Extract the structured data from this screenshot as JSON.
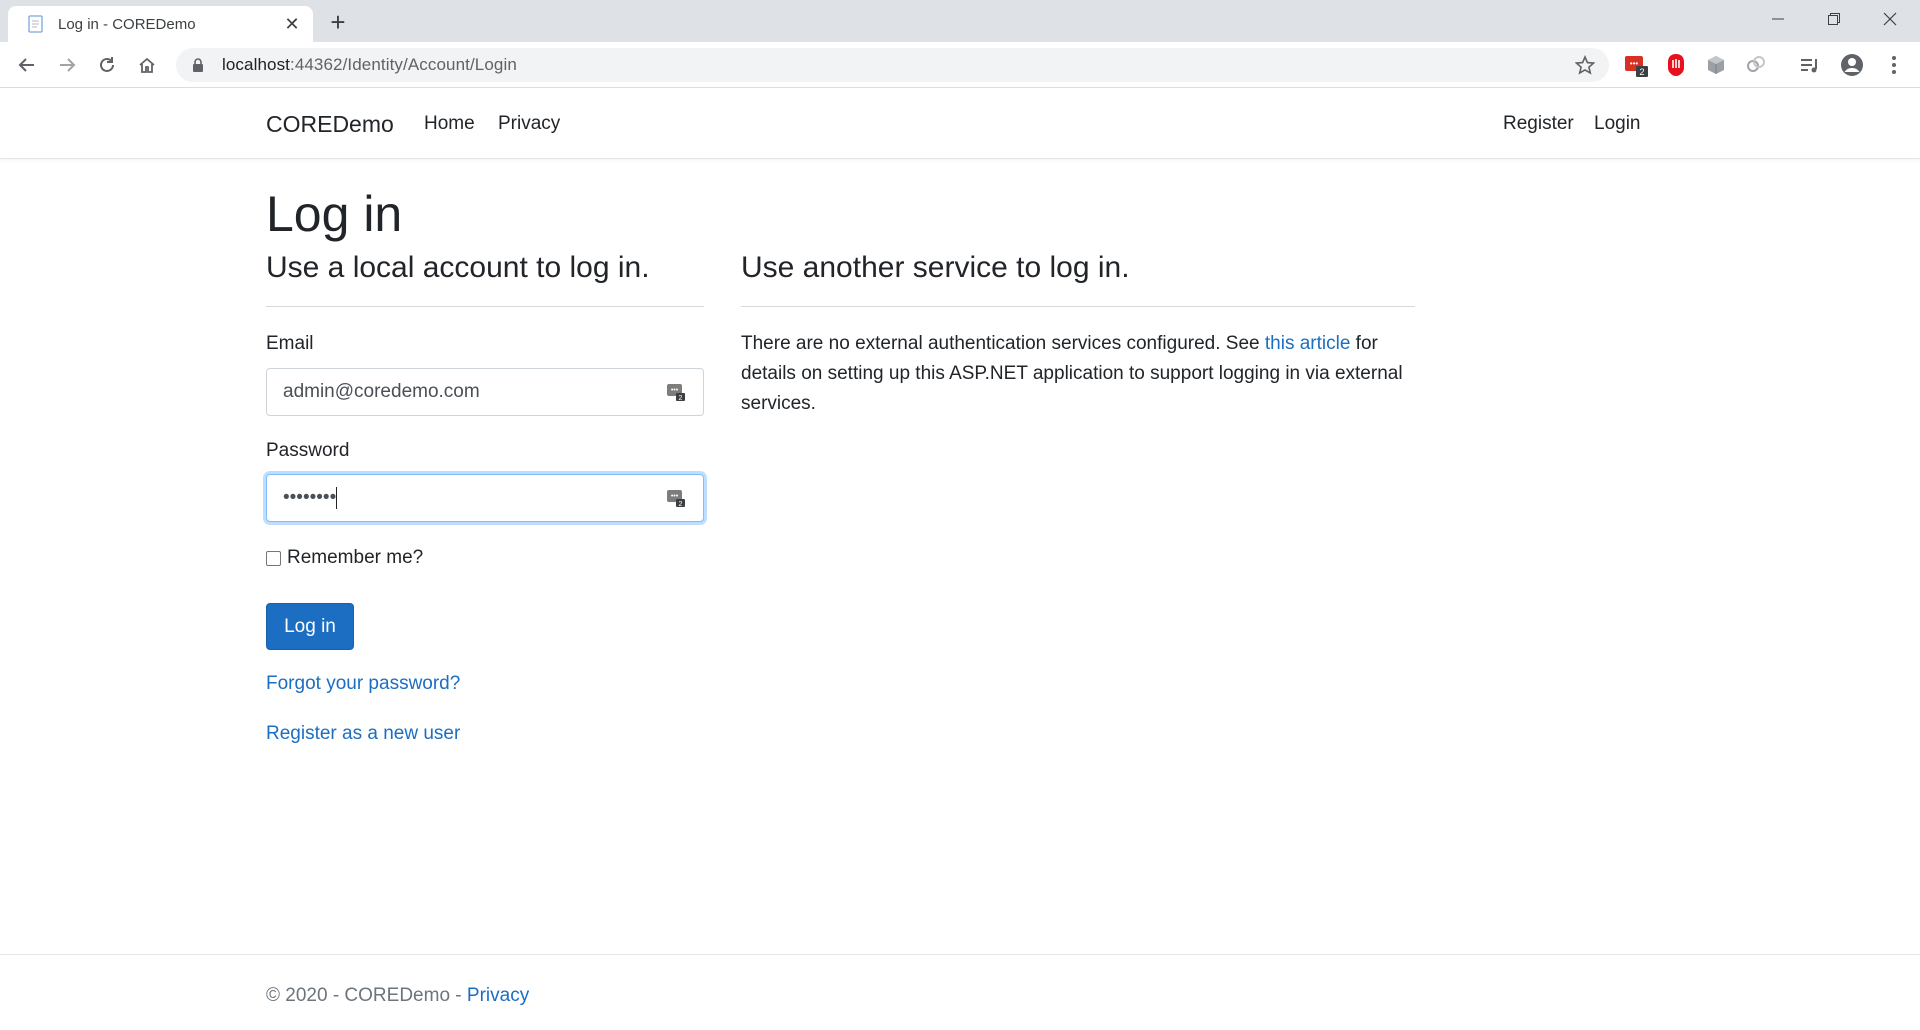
{
  "browser": {
    "tab_title": "Log in - COREDemo",
    "new_tab": "+",
    "url_host": "localhost",
    "url_rest": ":44362/Identity/Account/Login",
    "extension_badge": "2"
  },
  "navbar": {
    "brand": "COREDemo",
    "links": [
      "Home",
      "Privacy"
    ],
    "right_links": [
      "Register",
      "Login"
    ]
  },
  "main": {
    "title": "Log in",
    "local_heading": "Use a local account to log in.",
    "external_heading": "Use another service to log in.",
    "email_label": "Email",
    "email_value": "admin@coredemo.com",
    "password_label": "Password",
    "password_value": "••••••••",
    "remember_label": "Remember me?",
    "login_button": "Log in",
    "forgot_link": "Forgot your password?",
    "register_link": "Register as a new user",
    "external_text_before": "There are no external authentication services configured. See ",
    "external_link": "this article",
    "external_text_after": " for details on setting up this ASP.NET application to support logging in via external services."
  },
  "footer": {
    "text": "© 2020 - COREDemo - ",
    "privacy_link": "Privacy"
  },
  "colors": {
    "primary": "#1b6ec2",
    "link": "#1b6ec2",
    "focus_border": "#80bdff",
    "extension_red": "#d93025"
  }
}
